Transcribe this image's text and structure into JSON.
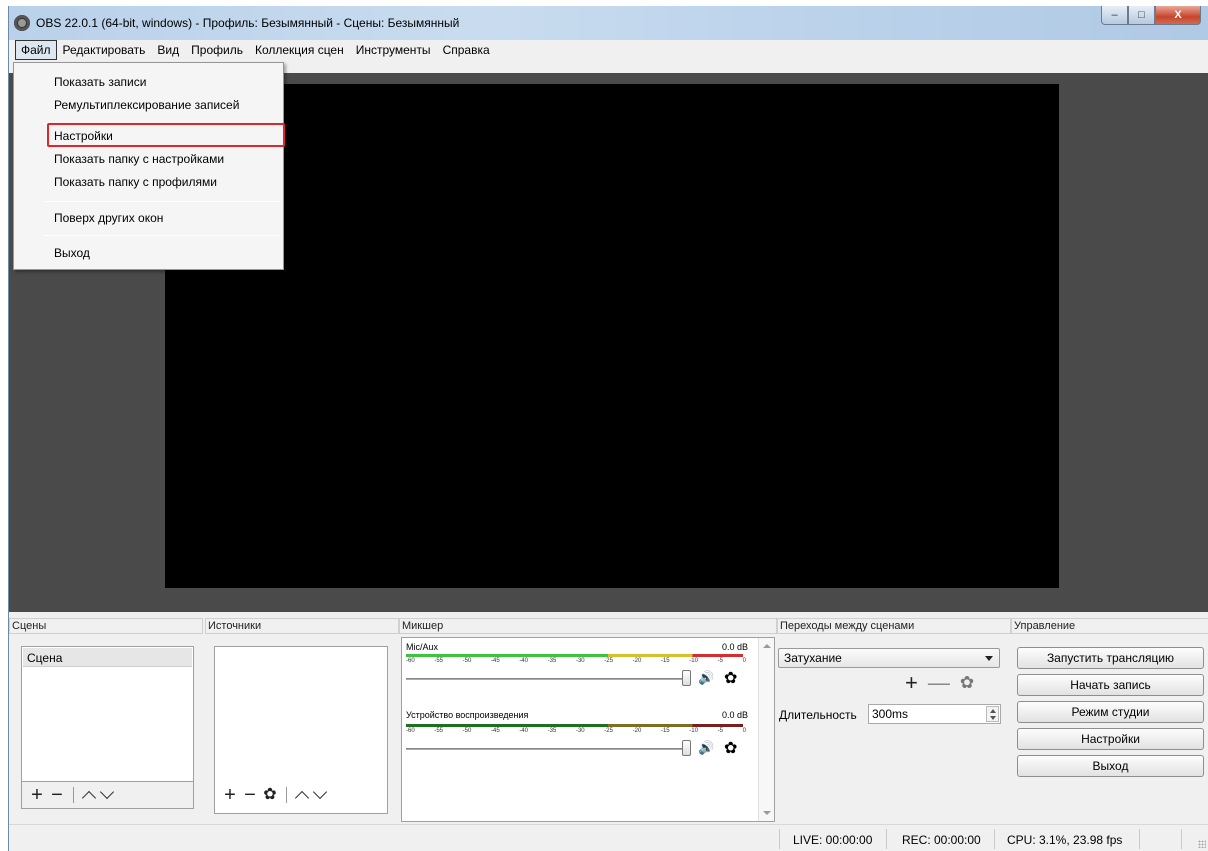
{
  "window": {
    "title": "OBS 22.0.1 (64-bit, windows) - Профиль: Безымянный - Сцены: Безымянный",
    "icon": "obs-logo-icon",
    "controls": {
      "minimize": "–",
      "maximize": "□",
      "close": "X"
    }
  },
  "menubar": {
    "items": [
      "Файл",
      "Редактировать",
      "Вид",
      "Профиль",
      "Коллекция сцен",
      "Инструменты",
      "Справка"
    ],
    "active": "Файл"
  },
  "file_menu": {
    "items": [
      "Показать записи",
      "Ремультиплексирование записей",
      "Настройки",
      "Показать папку с настройками",
      "Показать папку с профилями",
      "Поверх других окон",
      "Выход"
    ],
    "highlighted": "Настройки",
    "highlight_color": "#e0262a"
  },
  "docks": {
    "scenes": {
      "title": "Сцены",
      "items": [
        "Сцена"
      ]
    },
    "sources": {
      "title": "Источники"
    },
    "mixer": {
      "title": "Микшер",
      "scale": [
        "-60",
        "-55",
        "-50",
        "-45",
        "-40",
        "-35",
        "-30",
        "-25",
        "-20",
        "-15",
        "-10",
        "-5",
        "0"
      ],
      "channels": [
        {
          "name": "Mic/Aux",
          "db": "0.0 dB"
        },
        {
          "name": "Устройство воспроизведения",
          "db": "0.0 dB"
        }
      ]
    },
    "transitions": {
      "title": "Переходы между сценами",
      "selected": "Затухание",
      "duration_label": "Длительность",
      "duration_value": "300ms"
    },
    "controls": {
      "title": "Управление",
      "buttons": [
        "Запустить трансляцию",
        "Начать запись",
        "Режим студии",
        "Настройки",
        "Выход"
      ]
    }
  },
  "statusbar": {
    "live": "LIVE: 00:00:00",
    "rec": "REC: 00:00:00",
    "cpu": "CPU: 3.1%, 23.98 fps"
  },
  "colors": {
    "preview_bg": "#4a4a4a",
    "canvas": "#000000",
    "meter_green": "#3fc23f",
    "meter_yellow": "#d4c030",
    "meter_red": "#d03030"
  }
}
